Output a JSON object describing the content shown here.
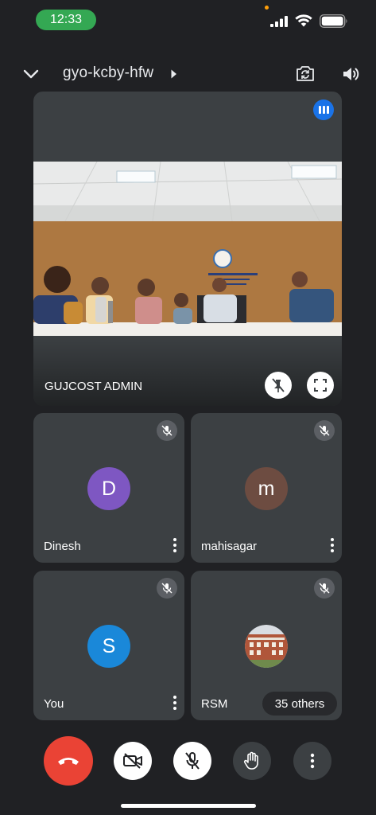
{
  "status_bar": {
    "time": "12:33"
  },
  "header": {
    "meeting_code": "gyo-kcby-hfw"
  },
  "main_tile": {
    "participant_name": "GUJCOST ADMIN"
  },
  "tiles": [
    {
      "name": "Dinesh",
      "initial": "D",
      "avatar_color": "#7e57c2"
    },
    {
      "name": "mahisagar",
      "initial": "m",
      "avatar_color": "#6d4c41"
    },
    {
      "name": "You",
      "initial": "S",
      "avatar_color": "#1a88d9"
    },
    {
      "name": "RSM",
      "others_label": "35 others"
    }
  ],
  "colors": {
    "background": "#202124",
    "tile": "#3c4043",
    "end_call": "#ea4335",
    "active_speaker": "#1a73e8",
    "time_pill": "#34a853"
  }
}
